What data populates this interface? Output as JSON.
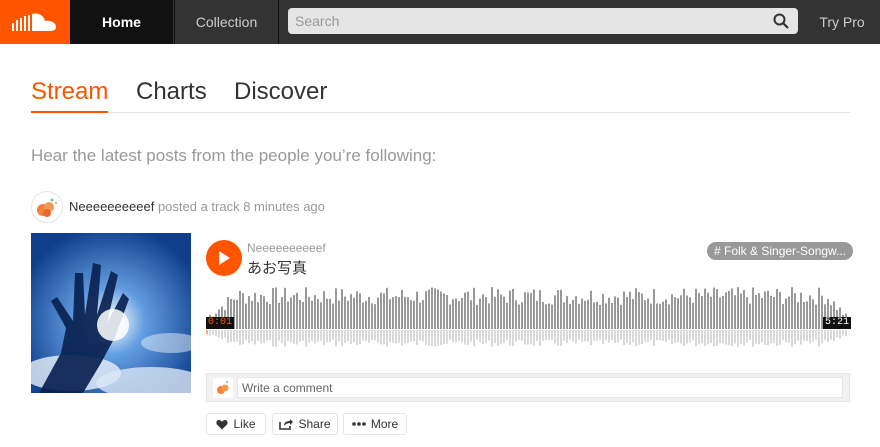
{
  "brand": {
    "accent": "#ff5500",
    "header_bg": "#333333"
  },
  "nav": {
    "home": "Home",
    "collection": "Collection",
    "try_pro": "Try Pro"
  },
  "search": {
    "placeholder": "Search"
  },
  "tabs": {
    "stream": "Stream",
    "charts": "Charts",
    "discover": "Discover"
  },
  "stream": {
    "subtitle": "Hear the latest posts from the people you’re following:"
  },
  "post": {
    "user": "Neeeeeeeeeef",
    "action": "posted a track",
    "time_ago": "8 minutes ago",
    "track": {
      "artist": "Neeeeeeeeeef",
      "title": "あお写真",
      "tag": "# Folk & Singer-Songw...",
      "current_time": "0:01",
      "duration": "5:21"
    },
    "comment": {
      "placeholder": "Write a comment"
    },
    "actions": {
      "like": "Like",
      "share": "Share",
      "more": "More"
    }
  }
}
